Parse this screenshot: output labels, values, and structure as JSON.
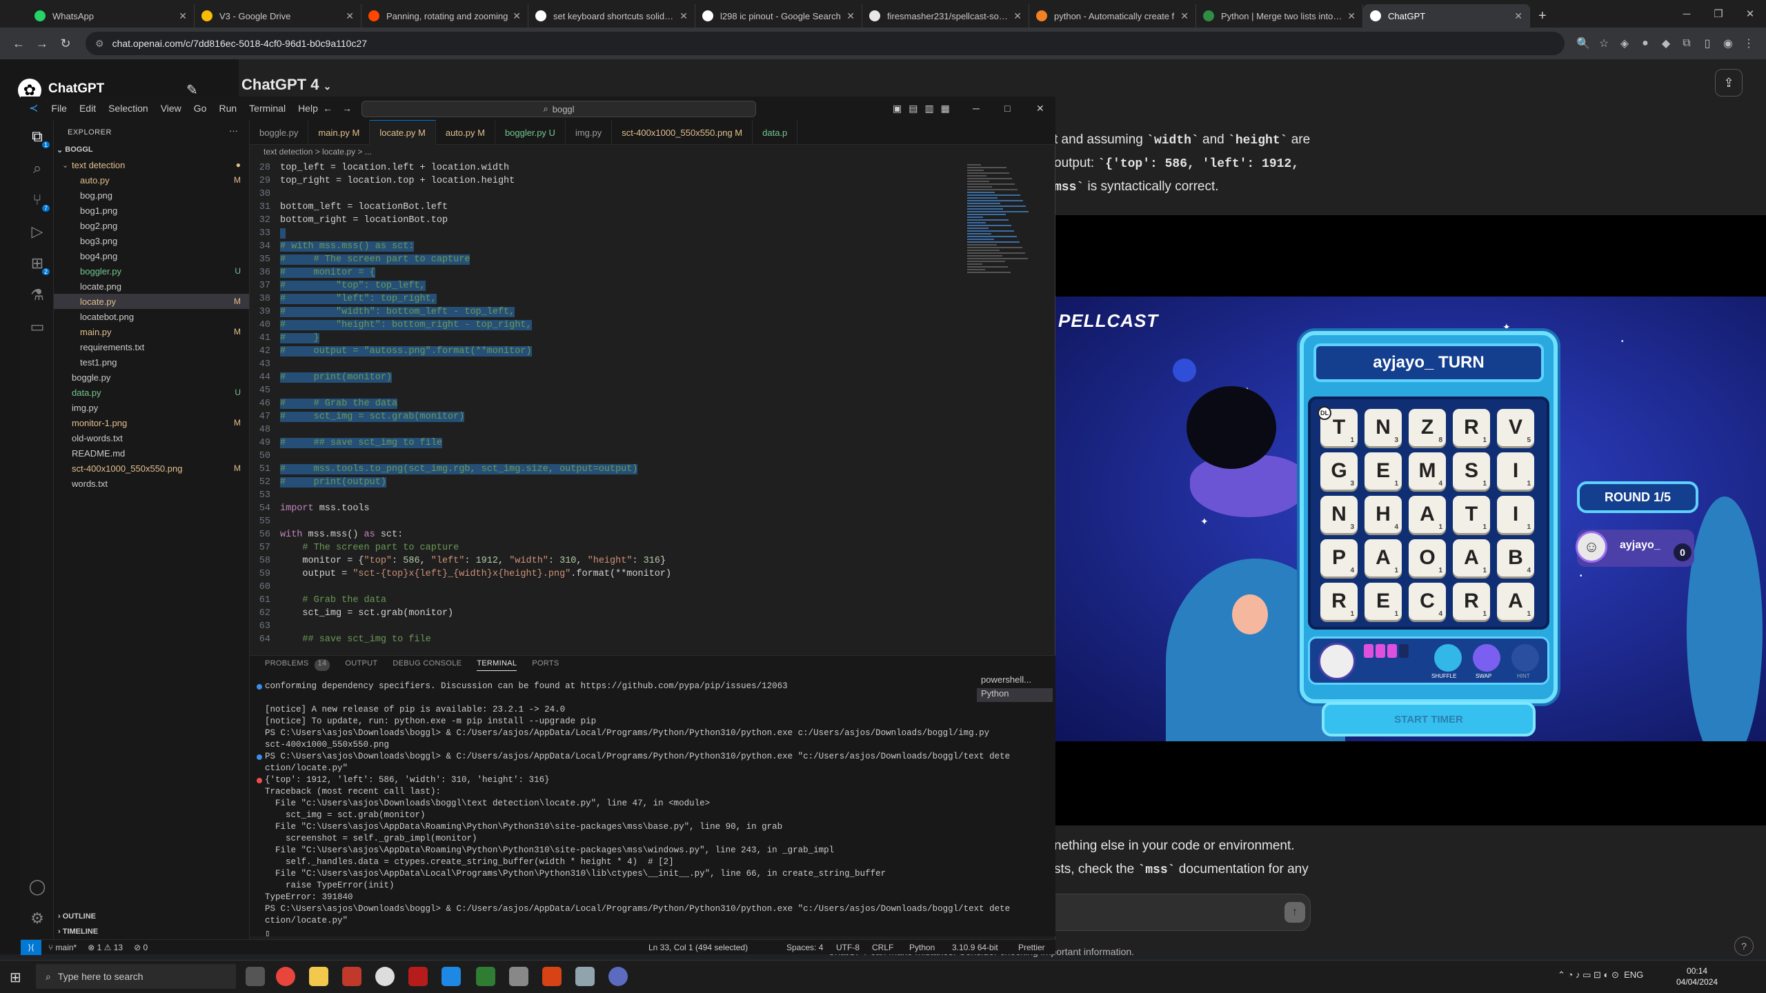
{
  "browser": {
    "tabs": [
      {
        "title": "WhatsApp",
        "color": "#25d366",
        "active": false
      },
      {
        "title": "V3 - Google Drive",
        "color": "#fbbc04",
        "active": false
      },
      {
        "title": "Panning, rotating and zooming",
        "color": "#ff4500",
        "active": false
      },
      {
        "title": "set keyboard shortcuts solidwo",
        "color": "#ffffff",
        "active": false
      },
      {
        "title": "l298 ic pinout - Google Search",
        "color": "#ffffff",
        "active": false
      },
      {
        "title": "firesmasher231/spellcast-solver",
        "color": "#e8e8e8",
        "active": false
      },
      {
        "title": "python - Automatically create f",
        "color": "#f48024",
        "active": false
      },
      {
        "title": "Python | Merge two lists into lis",
        "color": "#2f8d46",
        "active": false
      },
      {
        "title": "ChatGPT",
        "color": "#ffffff",
        "active": true
      }
    ],
    "url": "chat.openai.com/c/7dd816ec-5018-4cf0-96d1-b0c9a110c27"
  },
  "chatgpt": {
    "brand": "ChatGPT",
    "model_title": "ChatGPT 4",
    "messages_top": [
      {
        "pre": "t and assuming ",
        "c1": "`width`",
        "mid": " and ",
        "c2": "`height`",
        "post": " are"
      },
      {
        "pre": "output: ",
        "c1": "`{'top': 586, 'left': 1912,",
        "mid": "",
        "c2": "",
        "post": ""
      },
      {
        "pre": "",
        "c1": "mss`",
        "mid": "",
        "c2": "",
        "post": " is syntactically correct."
      }
    ],
    "messages_bottom": [
      {
        "pre": "nething else in your code or environment.",
        "c1": "",
        "post": ""
      },
      {
        "pre": "sts, check the ",
        "c1": "`mss`",
        "post": " documentation for any"
      }
    ],
    "disclaimer": "ChatGPT can make mistakes. Consider checking important information."
  },
  "game": {
    "logo": "PELLCAST",
    "turn_text": "ayjayo_ TURN",
    "grid": [
      [
        "T",
        "N",
        "Z",
        "R",
        "V"
      ],
      [
        "G",
        "E",
        "M",
        "S",
        "I"
      ],
      [
        "N",
        "H",
        "A",
        "T",
        "I"
      ],
      [
        "P",
        "A",
        "O",
        "A",
        "B"
      ],
      [
        "R",
        "E",
        "C",
        "R",
        "A"
      ]
    ],
    "scores": [
      [
        "1",
        "3",
        "8",
        "1",
        "5"
      ],
      [
        "3",
        "1",
        "4",
        "1",
        "1"
      ],
      [
        "3",
        "4",
        "1",
        "1",
        "1"
      ],
      [
        "4",
        "1",
        "1",
        "1",
        "4"
      ],
      [
        "1",
        "1",
        "4",
        "1",
        "1"
      ]
    ],
    "dl": "DL",
    "round": "ROUND 1/5",
    "player_name": "ayjayo_",
    "player_score": "0",
    "start_timer": "START TIMER",
    "power_labels": [
      "SHUFFLE",
      "SWAP",
      "HINT"
    ]
  },
  "vscode": {
    "menu": [
      "File",
      "Edit",
      "Selection",
      "View",
      "Go",
      "Run",
      "Terminal",
      "Help"
    ],
    "search": "boggl",
    "explorer_title": "EXPLORER",
    "root": "BOGGL",
    "files": [
      {
        "name": "text detection",
        "indent": 1,
        "folder": true,
        "status": "●",
        "color": "#e2c08d"
      },
      {
        "name": "auto.py",
        "indent": 2,
        "status": "M",
        "color": "#e2c08d"
      },
      {
        "name": "bog.png",
        "indent": 2,
        "status": "",
        "color": "#cccccc"
      },
      {
        "name": "bog1.png",
        "indent": 2,
        "status": "",
        "color": "#cccccc"
      },
      {
        "name": "bog2.png",
        "indent": 2,
        "status": "",
        "color": "#cccccc"
      },
      {
        "name": "bog3.png",
        "indent": 2,
        "status": "",
        "color": "#cccccc"
      },
      {
        "name": "bog4.png",
        "indent": 2,
        "status": "",
        "color": "#cccccc"
      },
      {
        "name": "boggler.py",
        "indent": 2,
        "status": "U",
        "color": "#73c991"
      },
      {
        "name": "locate.png",
        "indent": 2,
        "status": "",
        "color": "#cccccc"
      },
      {
        "name": "locate.py",
        "indent": 2,
        "status": "M",
        "color": "#e2c08d",
        "selected": true
      },
      {
        "name": "locatebot.png",
        "indent": 2,
        "status": "",
        "color": "#cccccc"
      },
      {
        "name": "main.py",
        "indent": 2,
        "status": "M",
        "color": "#e2c08d"
      },
      {
        "name": "requirements.txt",
        "indent": 2,
        "status": "",
        "color": "#cccccc"
      },
      {
        "name": "test1.png",
        "indent": 2,
        "status": "",
        "color": "#cccccc"
      },
      {
        "name": "boggle.py",
        "indent": 1,
        "status": "",
        "color": "#cccccc"
      },
      {
        "name": "data.py",
        "indent": 1,
        "status": "U",
        "color": "#73c991"
      },
      {
        "name": "img.py",
        "indent": 1,
        "status": "",
        "color": "#cccccc"
      },
      {
        "name": "monitor-1.png",
        "indent": 1,
        "status": "M",
        "color": "#e2c08d"
      },
      {
        "name": "old-words.txt",
        "indent": 1,
        "status": "",
        "color": "#cccccc"
      },
      {
        "name": "README.md",
        "indent": 1,
        "status": "",
        "color": "#cccccc"
      },
      {
        "name": "sct-400x1000_550x550.png",
        "indent": 1,
        "status": "M",
        "color": "#e2c08d"
      },
      {
        "name": "words.txt",
        "indent": 1,
        "status": "",
        "color": "#cccccc"
      }
    ],
    "outline": "OUTLINE",
    "timeline": "TIMELINE",
    "tabs": [
      {
        "label": "boggle.py",
        "active": false,
        "color": "#9d9d9d"
      },
      {
        "label": "main.py M",
        "active": false,
        "color": "#e2c08d"
      },
      {
        "label": "locate.py M",
        "active": true,
        "color": "#e2c08d"
      },
      {
        "label": "auto.py M",
        "active": false,
        "color": "#e2c08d"
      },
      {
        "label": "boggler.py U",
        "active": false,
        "color": "#73c991"
      },
      {
        "label": "img.py",
        "active": false,
        "color": "#9d9d9d"
      },
      {
        "label": "sct-400x1000_550x550.png M",
        "active": false,
        "color": "#e2c08d"
      },
      {
        "label": "data.p",
        "active": false,
        "color": "#73c991"
      }
    ],
    "breadcrumb": "text detection  >  locate.py  > ...",
    "code": [
      {
        "n": "28",
        "t": "top_left = location.left + location.width",
        "hl": false
      },
      {
        "n": "29",
        "t": "top_right = location.top + location.height",
        "hl": false
      },
      {
        "n": "30",
        "t": "",
        "hl": false
      },
      {
        "n": "31",
        "t": "bottom_left = locationBot.left",
        "hl": false
      },
      {
        "n": "32",
        "t": "bottom_right = locationBot.top",
        "hl": false
      },
      {
        "n": "33",
        "t": " ",
        "hl": true
      },
      {
        "n": "34",
        "t": "# with mss.mss() as sct:",
        "hl": true
      },
      {
        "n": "35",
        "t": "#     # The screen part to capture",
        "hl": true
      },
      {
        "n": "36",
        "t": "#     monitor = {",
        "hl": true
      },
      {
        "n": "37",
        "t": "#         \"top\": top_left,",
        "hl": true
      },
      {
        "n": "38",
        "t": "#         \"left\": top_right,",
        "hl": true
      },
      {
        "n": "39",
        "t": "#         \"width\": bottom_left - top_left,",
        "hl": true
      },
      {
        "n": "40",
        "t": "#         \"height\": bottom_right - top_right,",
        "hl": true
      },
      {
        "n": "41",
        "t": "#     }",
        "hl": true
      },
      {
        "n": "42",
        "t": "#     output = \"autoss.png\".format(**monitor)",
        "hl": true
      },
      {
        "n": "43",
        "t": "",
        "hl": true
      },
      {
        "n": "44",
        "t": "#     print(monitor)",
        "hl": true
      },
      {
        "n": "45",
        "t": "",
        "hl": true
      },
      {
        "n": "46",
        "t": "#     # Grab the data",
        "hl": true
      },
      {
        "n": "47",
        "t": "#     sct_img = sct.grab(monitor)",
        "hl": true
      },
      {
        "n": "48",
        "t": "",
        "hl": true
      },
      {
        "n": "49",
        "t": "#     ## save sct_img to file",
        "hl": true
      },
      {
        "n": "50",
        "t": "",
        "hl": true
      },
      {
        "n": "51",
        "t": "#     mss.tools.to_png(sct_img.rgb, sct_img.size, output=output)",
        "hl": true
      },
      {
        "n": "52",
        "t": "#     print(output)",
        "hl": true
      },
      {
        "n": "53",
        "t": "",
        "hl": false
      },
      {
        "n": "54",
        "t": "import mss.tools",
        "hl": false
      },
      {
        "n": "55",
        "t": "",
        "hl": false
      },
      {
        "n": "56",
        "t": "with mss.mss() as sct:",
        "hl": false
      },
      {
        "n": "57",
        "t": "    # The screen part to capture",
        "hl": false
      },
      {
        "n": "58",
        "t": "    monitor = {\"top\": 586, \"left\": 1912, \"width\": 310, \"height\": 316}",
        "hl": false
      },
      {
        "n": "59",
        "t": "    output = \"sct-{top}x{left}_{width}x{height}.png\".format(**monitor)",
        "hl": false
      },
      {
        "n": "60",
        "t": "",
        "hl": false
      },
      {
        "n": "61",
        "t": "    # Grab the data",
        "hl": false
      },
      {
        "n": "62",
        "t": "    sct_img = sct.grab(monitor)",
        "hl": false
      },
      {
        "n": "63",
        "t": "",
        "hl": false
      },
      {
        "n": "64",
        "t": "    ## save sct_img to file",
        "hl": false
      }
    ],
    "panel_tabs": [
      "PROBLEMS",
      "14",
      "OUTPUT",
      "DEBUG CONSOLE",
      "TERMINAL",
      "PORTS"
    ],
    "terminal": [
      {
        "dot": "#3b8eea",
        "t": "conforming dependency specifiers. Discussion can be found at https://github.com/pypa/pip/issues/12063"
      },
      {
        "dot": "",
        "t": ""
      },
      {
        "dot": "",
        "t": "[notice] A new release of pip is available: 23.2.1 -> 24.0"
      },
      {
        "dot": "",
        "t": "[notice] To update, run: python.exe -m pip install --upgrade pip"
      },
      {
        "dot": "",
        "t": "PS C:\\Users\\asjos\\Downloads\\boggl> & C:/Users/asjos/AppData/Local/Programs/Python/Python310/python.exe c:/Users/asjos/Downloads/boggl/img.py"
      },
      {
        "dot": "",
        "t": "sct-400x1000_550x550.png"
      },
      {
        "dot": "#3b8eea",
        "t": "PS C:\\Users\\asjos\\Downloads\\boggl> & C:/Users/asjos/AppData/Local/Programs/Python/Python310/python.exe \"c:/Users/asjos/Downloads/boggl/text dete"
      },
      {
        "dot": "",
        "t": "ction/locate.py\""
      },
      {
        "dot": "#f14c4c",
        "t": "{'top': 1912, 'left': 586, 'width': 310, 'height': 316}"
      },
      {
        "dot": "",
        "t": "Traceback (most recent call last):"
      },
      {
        "dot": "",
        "t": "  File \"c:\\Users\\asjos\\Downloads\\boggl\\text detection\\locate.py\", line 47, in <module>"
      },
      {
        "dot": "",
        "t": "    sct_img = sct.grab(monitor)"
      },
      {
        "dot": "",
        "t": "  File \"C:\\Users\\asjos\\AppData\\Roaming\\Python\\Python310\\site-packages\\mss\\base.py\", line 90, in grab"
      },
      {
        "dot": "",
        "t": "    screenshot = self._grab_impl(monitor)"
      },
      {
        "dot": "",
        "t": "  File \"C:\\Users\\asjos\\AppData\\Roaming\\Python\\Python310\\site-packages\\mss\\windows.py\", line 243, in _grab_impl"
      },
      {
        "dot": "",
        "t": "    self._handles.data = ctypes.create_string_buffer(width * height * 4)  # [2]"
      },
      {
        "dot": "",
        "t": "  File \"C:\\Users\\asjos\\AppData\\Local\\Programs\\Python\\Python310\\lib\\ctypes\\__init__.py\", line 66, in create_string_buffer"
      },
      {
        "dot": "",
        "t": "    raise TypeError(init)"
      },
      {
        "dot": "",
        "t": "TypeError: 391840"
      },
      {
        "dot": "",
        "t": "PS C:\\Users\\asjos\\Downloads\\boggl> & C:/Users/asjos/AppData/Local/Programs/Python/Python310/python.exe \"c:/Users/asjos/Downloads/boggl/text dete"
      },
      {
        "dot": "",
        "t": "ction/locate.py\""
      },
      {
        "dot": "",
        "t": "▯"
      }
    ],
    "terminal_list": [
      "powershell...",
      "Python"
    ],
    "status": {
      "branch": "main*",
      "problems": "⊗ 1 ⚠ 13",
      "ports": "⊘ 0",
      "position": "Ln 33, Col 1 (494 selected)",
      "spaces": "Spaces: 4",
      "encoding": "UTF-8",
      "eol": "CRLF",
      "language": "Python",
      "interpreter": "3.10.9 64-bit",
      "prettier": "Prettier"
    }
  },
  "taskbar": {
    "search_placeholder": "Type here to search",
    "tray": "ENG",
    "time": "00:14",
    "date": "04/04/2024"
  }
}
